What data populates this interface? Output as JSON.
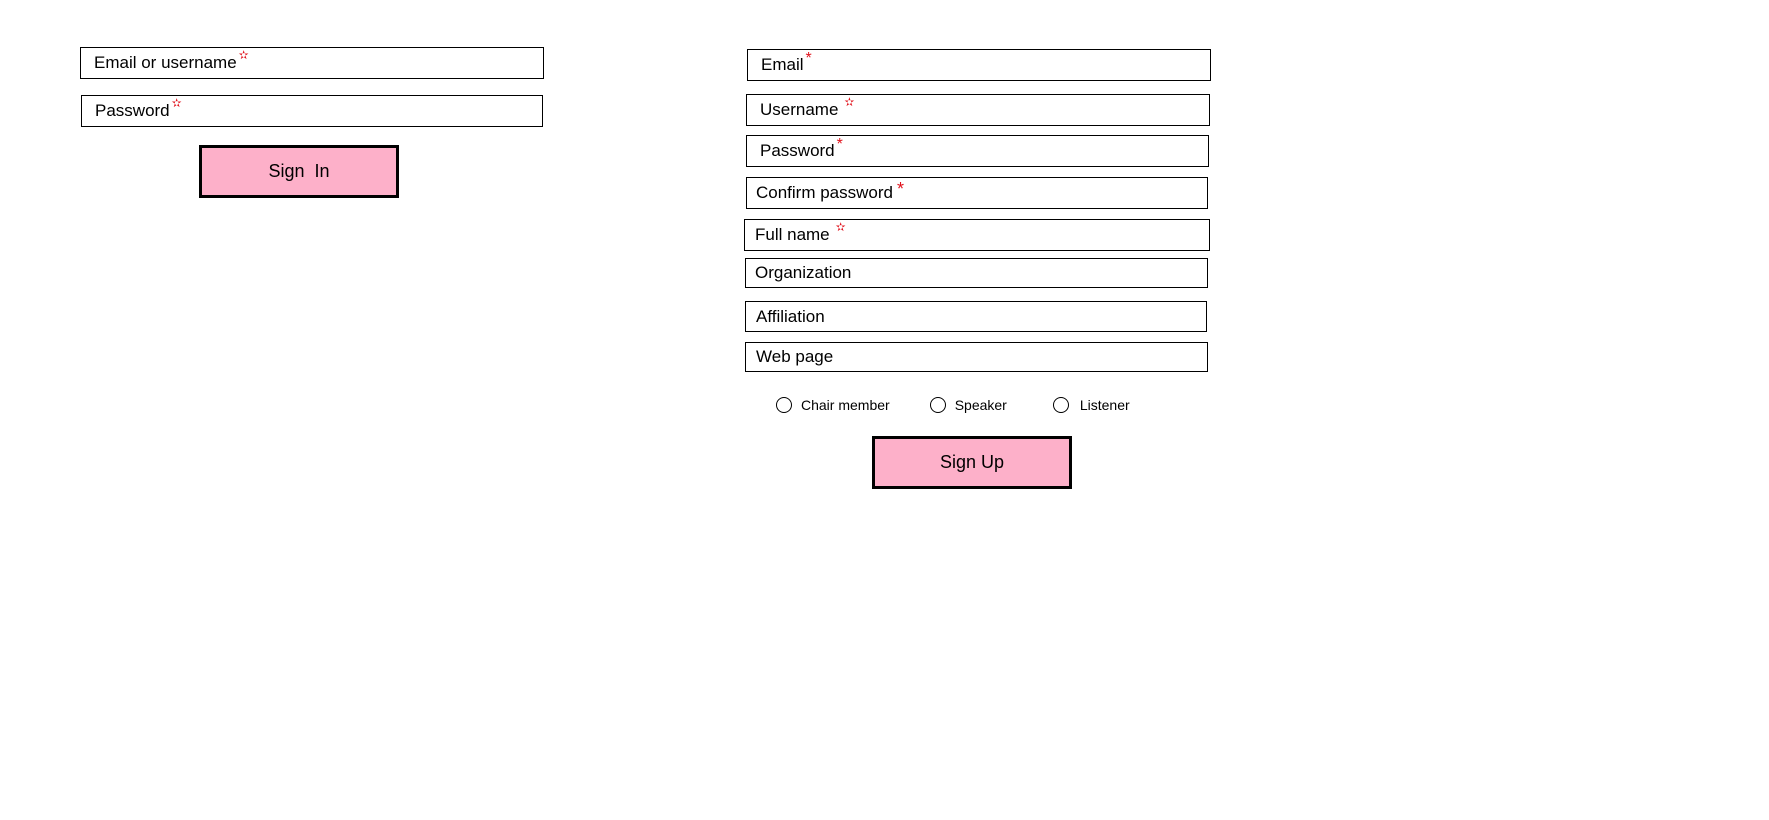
{
  "signin": {
    "fields": [
      {
        "label": "Email or username",
        "req": "✫"
      },
      {
        "label": "Password",
        "req": "✫"
      }
    ],
    "button": "Sign  In"
  },
  "signup": {
    "fields": [
      {
        "label": "Email",
        "req": "*"
      },
      {
        "label": "Username",
        "req": "✫"
      },
      {
        "label": "Password",
        "req": "*"
      },
      {
        "label": "Confirm password",
        "req": "*"
      },
      {
        "label": "Full name",
        "req": "✫"
      },
      {
        "label": "Organization"
      },
      {
        "label": "Affiliation"
      },
      {
        "label": "Web page"
      }
    ],
    "roles": [
      "Chair member",
      "Speaker",
      "Listener"
    ],
    "button": "Sign Up"
  },
  "colors": {
    "button_fill": "#fdb0c9",
    "required_mark": "#e0101a"
  }
}
